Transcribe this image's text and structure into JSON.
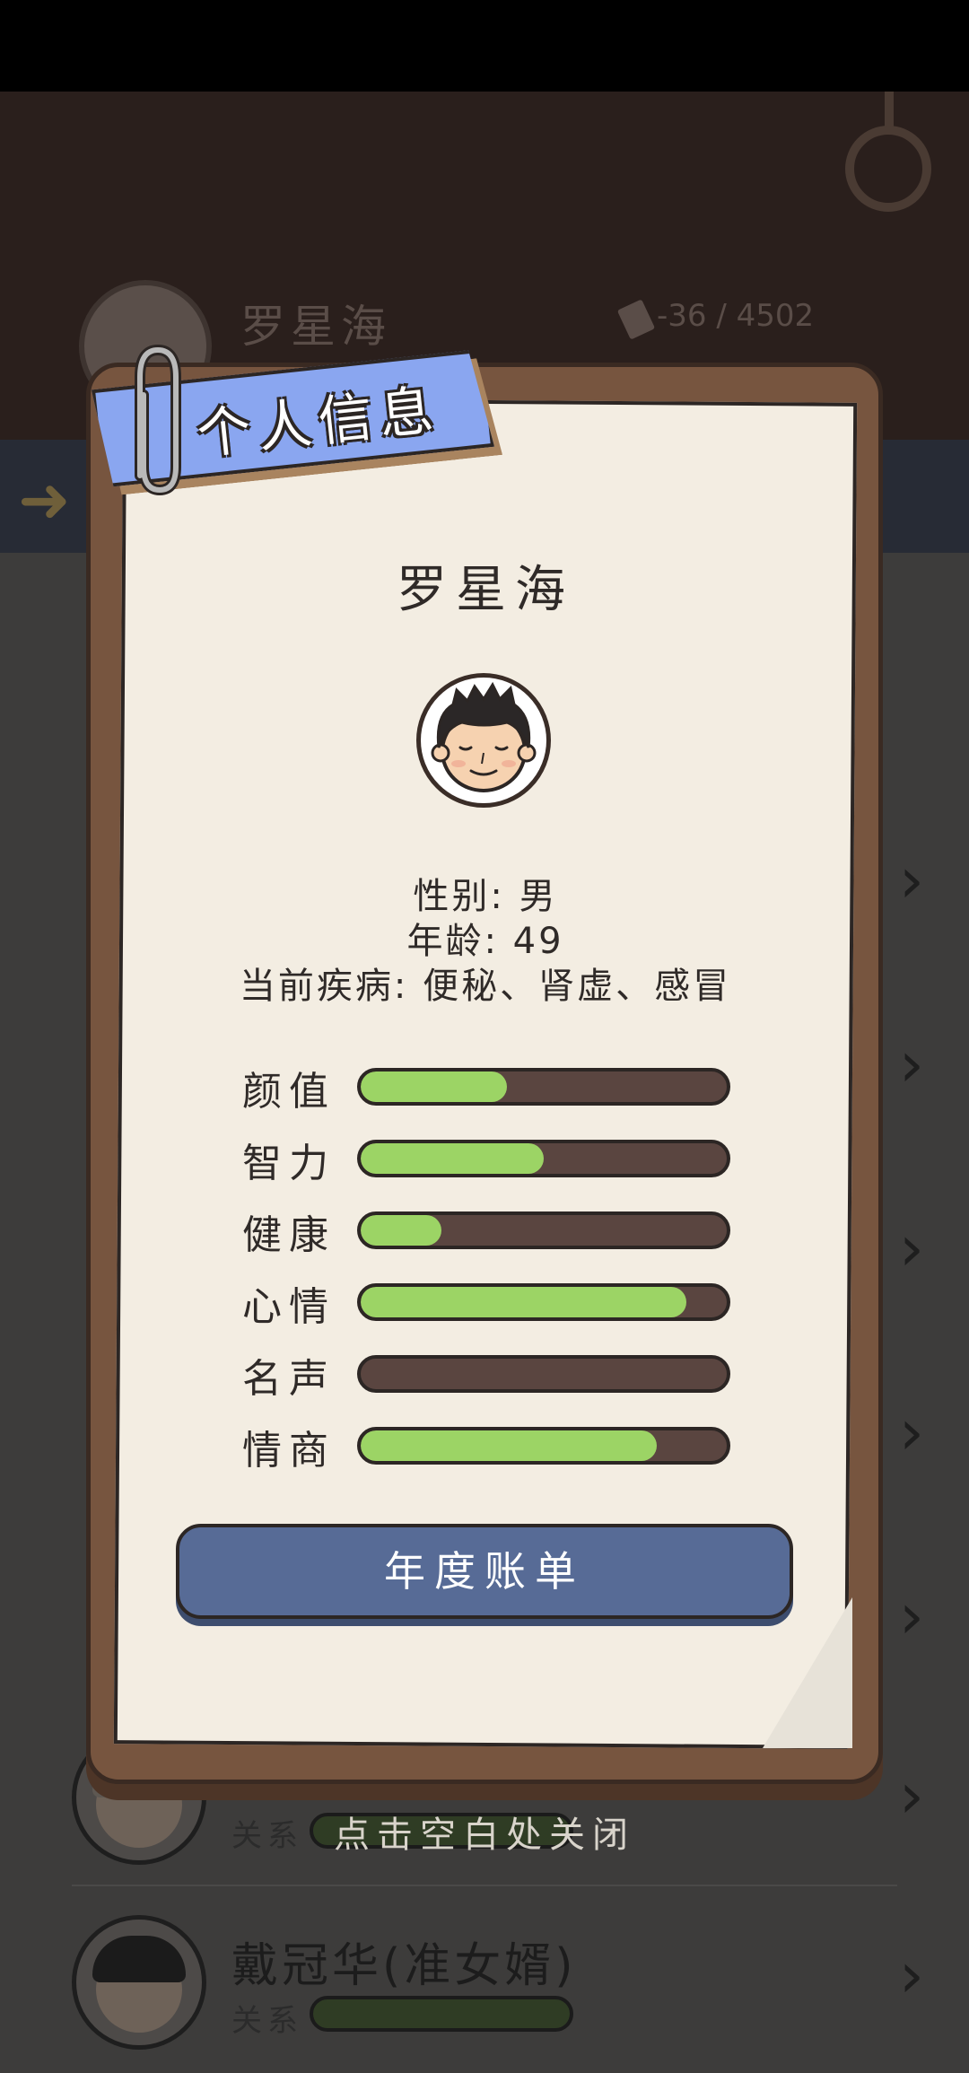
{
  "background": {
    "top_player_name": "罗星海",
    "money_text": "-36 / 4502",
    "rows": [
      {
        "name": "",
        "relation_label": ""
      },
      {
        "name": "",
        "relation_label": "关系"
      },
      {
        "name": "戴冠华(准女婿)",
        "relation_label": "关系"
      }
    ]
  },
  "modal": {
    "title": "个人信息",
    "name": "罗星海",
    "gender_line": "性别: 男",
    "age_line": "年龄: 49",
    "disease_line": "当前疾病: 便秘、肾虚、感冒",
    "stats": [
      {
        "label": "颜值",
        "value": 0.4
      },
      {
        "label": "智力",
        "value": 0.5
      },
      {
        "label": "健康",
        "value": 0.22
      },
      {
        "label": "心情",
        "value": 0.89
      },
      {
        "label": "名声",
        "value": 0.0
      },
      {
        "label": "情商",
        "value": 0.81
      }
    ],
    "annual_button": "年度账单",
    "close_hint": "点击空白处关闭"
  },
  "colors": {
    "frame": "#77553f",
    "paper": "#f3ede2",
    "ribbon": "#8aa6f0",
    "stat_fill": "#9cd465",
    "stat_track": "#5a4540",
    "button": "#576b96"
  }
}
